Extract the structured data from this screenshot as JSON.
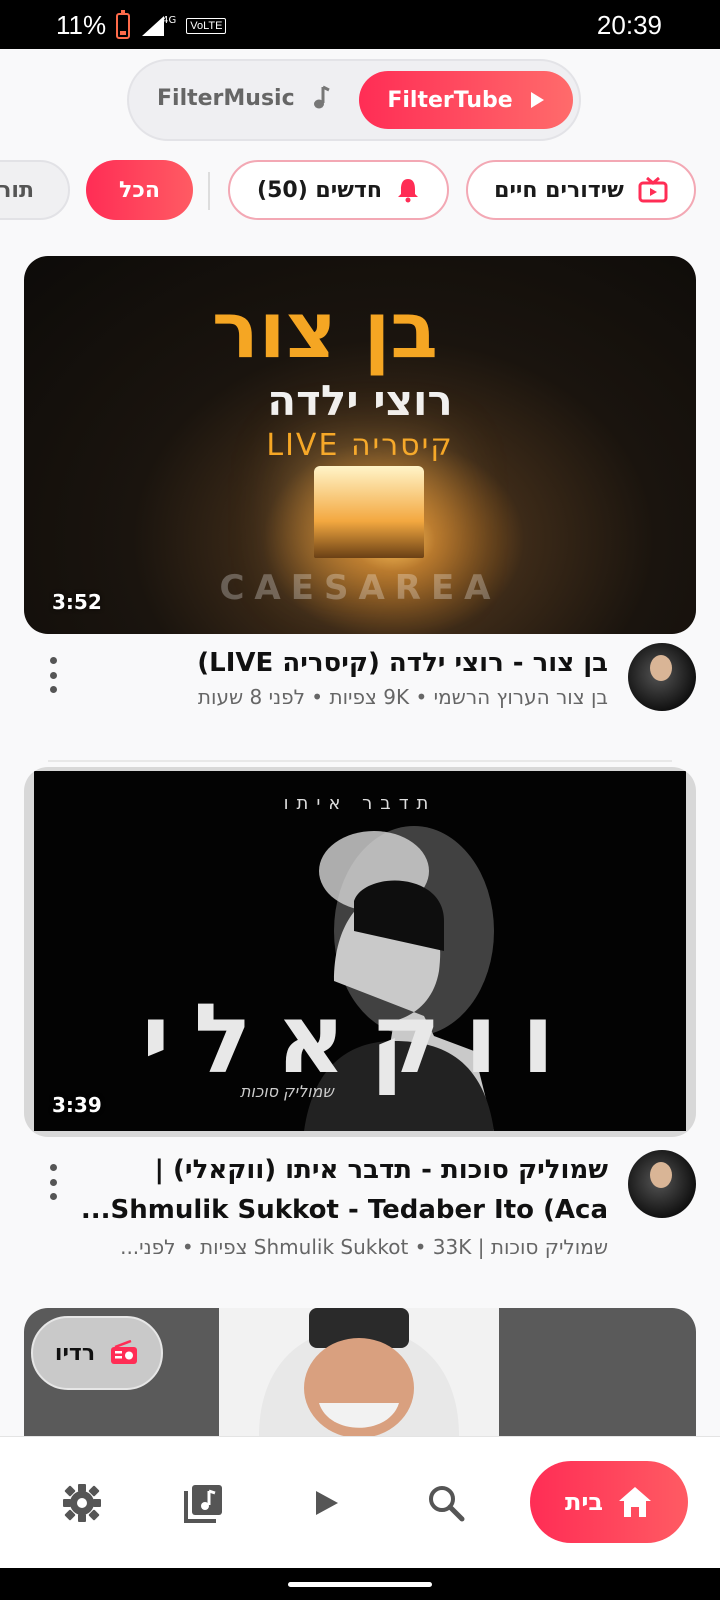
{
  "status_bar": {
    "battery_percent": "11%",
    "network_type": "4G",
    "volte": "VoLTE",
    "time": "20:39"
  },
  "mode_switch": {
    "music_label": "FilterMusic",
    "tube_label": "FilterTube",
    "active": "FilterTube"
  },
  "chips": {
    "live": "שידורים חיים",
    "new": "חדשים (50)",
    "all": "הכל",
    "torah": "תור"
  },
  "videos": [
    {
      "title": "בן צור - רוצי ילדה (קיסריה LIVE)",
      "subtitle": "בן צור הערוץ הרשמי • 9K צפיות • לפני 8 שעות",
      "duration": "3:52",
      "thumb_big": "בן צור",
      "thumb_mid": "רוצי ילדה",
      "thumb_sub": "LIVE קיסריה",
      "thumb_caption": "CAESAREA"
    },
    {
      "title": "שמוליק סוכות - תדבר איתו (ווקאלי) | Shmulik Sukkot - Tedaber Ito (Aca...",
      "subtitle": "שמוליק סוכות | Shmulik Sukkot • 33K צפיות • לפני...",
      "duration": "3:39",
      "thumb_small": "תדבר איתו",
      "thumb_big": "ווקאלי",
      "thumb_sign": "שמוליק סוכות"
    }
  ],
  "radio_button": {
    "label": "רדיו"
  },
  "bottom_nav": {
    "home_label": "בית",
    "items": [
      "settings-icon",
      "music-library-icon",
      "play-icon",
      "search-icon",
      "home-icon"
    ]
  },
  "colors": {
    "accent": "#ff2d55",
    "accent_end": "#ff6b6b"
  }
}
